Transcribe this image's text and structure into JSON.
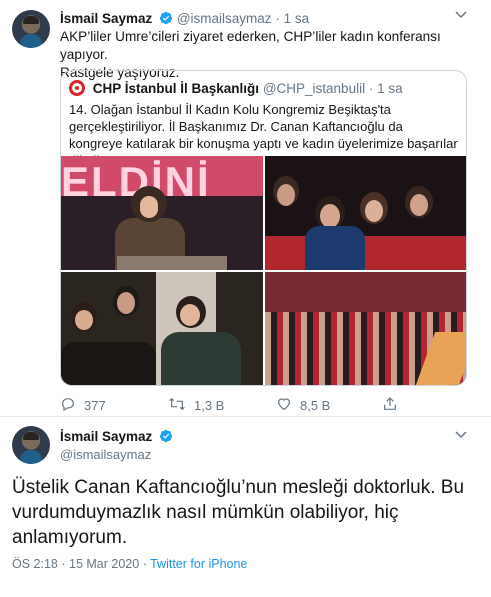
{
  "tweet1": {
    "author_name": "İsmail Saymaz",
    "handle": "@ismailsaymaz",
    "time": "1 sa",
    "text_line1": "AKP’liler Umre’cileri ziyaret ederken, CHP’liler kadın konferansı yapıyor.",
    "text_line2": "Rastgele yaşıyoruz.",
    "quote": {
      "author_name": "CHP İstanbul İl Başkanlığı",
      "handle": "@CHP_istanbulil",
      "time": "1 sa",
      "text": "14. Olağan İstanbul İl Kadın Kolu Kongremiz Beşiktaş'ta gerçekleştiriliyor. İl Başkanımız Dr. Canan Kaftancıoğlu da kongreye katılarak bir konuşma yaptı ve kadın üyelerimize  başarılar diledi.",
      "photo_banner": "ELDİNİ"
    },
    "actions": {
      "replies": "377",
      "retweets": "1,3 B",
      "likes": "8,5 B"
    }
  },
  "tweet2": {
    "author_name": "İsmail Saymaz",
    "handle": "@ismailsaymaz",
    "text": "Üstelik Canan Kaftancıoğlu’nun mesleği doktorluk. Bu vurdumduymazlık nasıl mümkün olabiliyor, hiç anlamıyorum.",
    "time": "ÖS 2:18",
    "date": "15 Mar 2020",
    "separator": "·",
    "source": "Twitter for iPhone"
  },
  "colors": {
    "verified": "#1da1f2",
    "muted": "#657786",
    "link": "#1b95e0",
    "border": "#ccd6dd"
  },
  "icons": [
    "chevron-down-icon",
    "verified-badge-icon",
    "reply-icon",
    "retweet-icon",
    "like-icon",
    "share-icon"
  ]
}
